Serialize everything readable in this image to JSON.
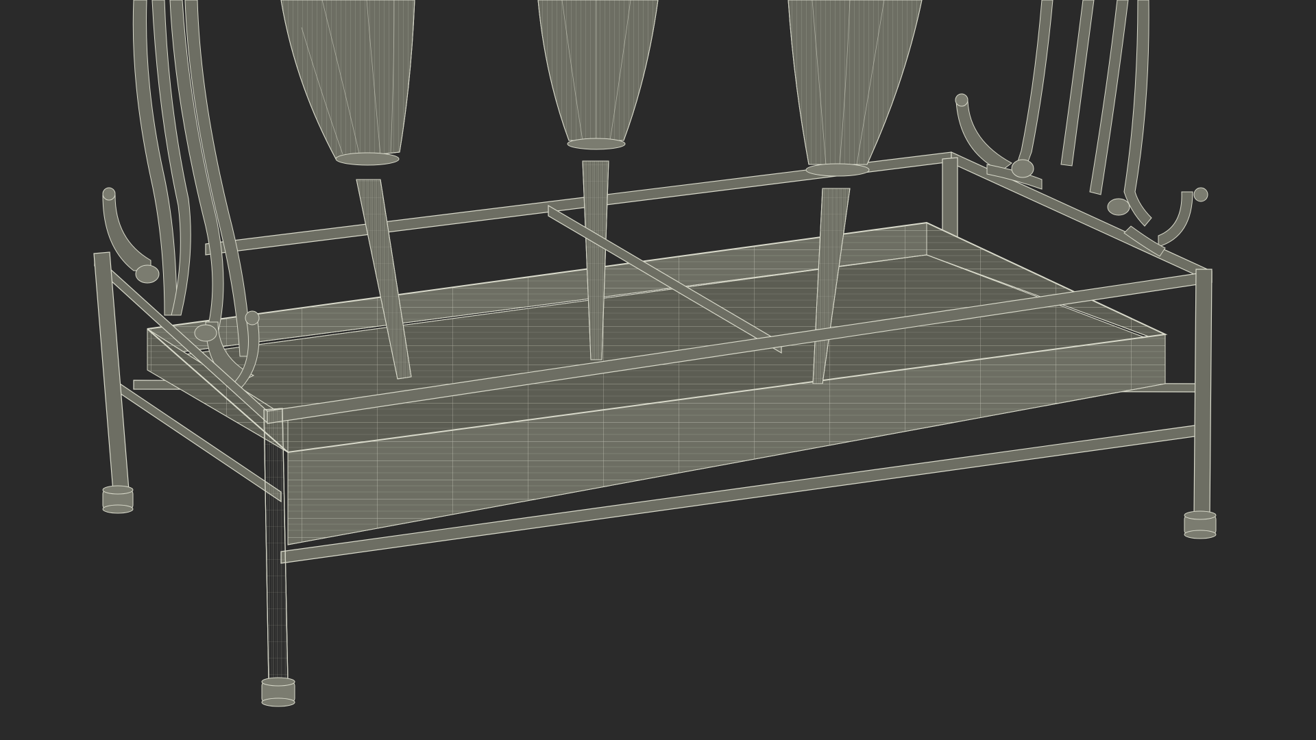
{
  "colors": {
    "background": "#2a2a2a",
    "surface": "#6d6e63",
    "surface_dark": "#5c5d53",
    "surface_light": "#7b7c70",
    "wire": "#d9dacb"
  }
}
